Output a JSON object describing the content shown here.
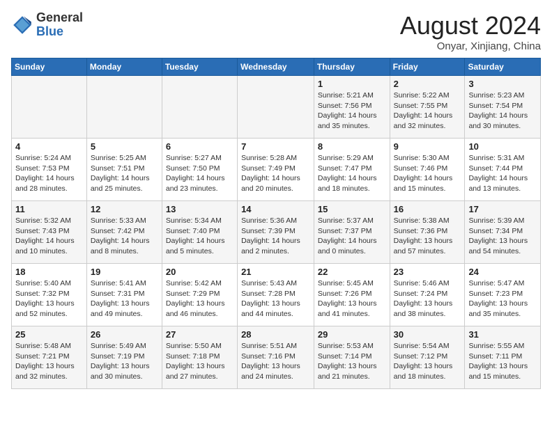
{
  "header": {
    "logo_general": "General",
    "logo_blue": "Blue",
    "month_title": "August 2024",
    "location": "Onyar, Xinjiang, China"
  },
  "days_of_week": [
    "Sunday",
    "Monday",
    "Tuesday",
    "Wednesday",
    "Thursday",
    "Friday",
    "Saturday"
  ],
  "weeks": [
    [
      {
        "day": "",
        "info": ""
      },
      {
        "day": "",
        "info": ""
      },
      {
        "day": "",
        "info": ""
      },
      {
        "day": "",
        "info": ""
      },
      {
        "day": "1",
        "sunrise": "Sunrise: 5:21 AM",
        "sunset": "Sunset: 7:56 PM",
        "daylight": "Daylight: 14 hours and 35 minutes."
      },
      {
        "day": "2",
        "sunrise": "Sunrise: 5:22 AM",
        "sunset": "Sunset: 7:55 PM",
        "daylight": "Daylight: 14 hours and 32 minutes."
      },
      {
        "day": "3",
        "sunrise": "Sunrise: 5:23 AM",
        "sunset": "Sunset: 7:54 PM",
        "daylight": "Daylight: 14 hours and 30 minutes."
      }
    ],
    [
      {
        "day": "4",
        "sunrise": "Sunrise: 5:24 AM",
        "sunset": "Sunset: 7:53 PM",
        "daylight": "Daylight: 14 hours and 28 minutes."
      },
      {
        "day": "5",
        "sunrise": "Sunrise: 5:25 AM",
        "sunset": "Sunset: 7:51 PM",
        "daylight": "Daylight: 14 hours and 25 minutes."
      },
      {
        "day": "6",
        "sunrise": "Sunrise: 5:27 AM",
        "sunset": "Sunset: 7:50 PM",
        "daylight": "Daylight: 14 hours and 23 minutes."
      },
      {
        "day": "7",
        "sunrise": "Sunrise: 5:28 AM",
        "sunset": "Sunset: 7:49 PM",
        "daylight": "Daylight: 14 hours and 20 minutes."
      },
      {
        "day": "8",
        "sunrise": "Sunrise: 5:29 AM",
        "sunset": "Sunset: 7:47 PM",
        "daylight": "Daylight: 14 hours and 18 minutes."
      },
      {
        "day": "9",
        "sunrise": "Sunrise: 5:30 AM",
        "sunset": "Sunset: 7:46 PM",
        "daylight": "Daylight: 14 hours and 15 minutes."
      },
      {
        "day": "10",
        "sunrise": "Sunrise: 5:31 AM",
        "sunset": "Sunset: 7:44 PM",
        "daylight": "Daylight: 14 hours and 13 minutes."
      }
    ],
    [
      {
        "day": "11",
        "sunrise": "Sunrise: 5:32 AM",
        "sunset": "Sunset: 7:43 PM",
        "daylight": "Daylight: 14 hours and 10 minutes."
      },
      {
        "day": "12",
        "sunrise": "Sunrise: 5:33 AM",
        "sunset": "Sunset: 7:42 PM",
        "daylight": "Daylight: 14 hours and 8 minutes."
      },
      {
        "day": "13",
        "sunrise": "Sunrise: 5:34 AM",
        "sunset": "Sunset: 7:40 PM",
        "daylight": "Daylight: 14 hours and 5 minutes."
      },
      {
        "day": "14",
        "sunrise": "Sunrise: 5:36 AM",
        "sunset": "Sunset: 7:39 PM",
        "daylight": "Daylight: 14 hours and 2 minutes."
      },
      {
        "day": "15",
        "sunrise": "Sunrise: 5:37 AM",
        "sunset": "Sunset: 7:37 PM",
        "daylight": "Daylight: 14 hours and 0 minutes."
      },
      {
        "day": "16",
        "sunrise": "Sunrise: 5:38 AM",
        "sunset": "Sunset: 7:36 PM",
        "daylight": "Daylight: 13 hours and 57 minutes."
      },
      {
        "day": "17",
        "sunrise": "Sunrise: 5:39 AM",
        "sunset": "Sunset: 7:34 PM",
        "daylight": "Daylight: 13 hours and 54 minutes."
      }
    ],
    [
      {
        "day": "18",
        "sunrise": "Sunrise: 5:40 AM",
        "sunset": "Sunset: 7:32 PM",
        "daylight": "Daylight: 13 hours and 52 minutes."
      },
      {
        "day": "19",
        "sunrise": "Sunrise: 5:41 AM",
        "sunset": "Sunset: 7:31 PM",
        "daylight": "Daylight: 13 hours and 49 minutes."
      },
      {
        "day": "20",
        "sunrise": "Sunrise: 5:42 AM",
        "sunset": "Sunset: 7:29 PM",
        "daylight": "Daylight: 13 hours and 46 minutes."
      },
      {
        "day": "21",
        "sunrise": "Sunrise: 5:43 AM",
        "sunset": "Sunset: 7:28 PM",
        "daylight": "Daylight: 13 hours and 44 minutes."
      },
      {
        "day": "22",
        "sunrise": "Sunrise: 5:45 AM",
        "sunset": "Sunset: 7:26 PM",
        "daylight": "Daylight: 13 hours and 41 minutes."
      },
      {
        "day": "23",
        "sunrise": "Sunrise: 5:46 AM",
        "sunset": "Sunset: 7:24 PM",
        "daylight": "Daylight: 13 hours and 38 minutes."
      },
      {
        "day": "24",
        "sunrise": "Sunrise: 5:47 AM",
        "sunset": "Sunset: 7:23 PM",
        "daylight": "Daylight: 13 hours and 35 minutes."
      }
    ],
    [
      {
        "day": "25",
        "sunrise": "Sunrise: 5:48 AM",
        "sunset": "Sunset: 7:21 PM",
        "daylight": "Daylight: 13 hours and 32 minutes."
      },
      {
        "day": "26",
        "sunrise": "Sunrise: 5:49 AM",
        "sunset": "Sunset: 7:19 PM",
        "daylight": "Daylight: 13 hours and 30 minutes."
      },
      {
        "day": "27",
        "sunrise": "Sunrise: 5:50 AM",
        "sunset": "Sunset: 7:18 PM",
        "daylight": "Daylight: 13 hours and 27 minutes."
      },
      {
        "day": "28",
        "sunrise": "Sunrise: 5:51 AM",
        "sunset": "Sunset: 7:16 PM",
        "daylight": "Daylight: 13 hours and 24 minutes."
      },
      {
        "day": "29",
        "sunrise": "Sunrise: 5:53 AM",
        "sunset": "Sunset: 7:14 PM",
        "daylight": "Daylight: 13 hours and 21 minutes."
      },
      {
        "day": "30",
        "sunrise": "Sunrise: 5:54 AM",
        "sunset": "Sunset: 7:12 PM",
        "daylight": "Daylight: 13 hours and 18 minutes."
      },
      {
        "day": "31",
        "sunrise": "Sunrise: 5:55 AM",
        "sunset": "Sunset: 7:11 PM",
        "daylight": "Daylight: 13 hours and 15 minutes."
      }
    ]
  ]
}
